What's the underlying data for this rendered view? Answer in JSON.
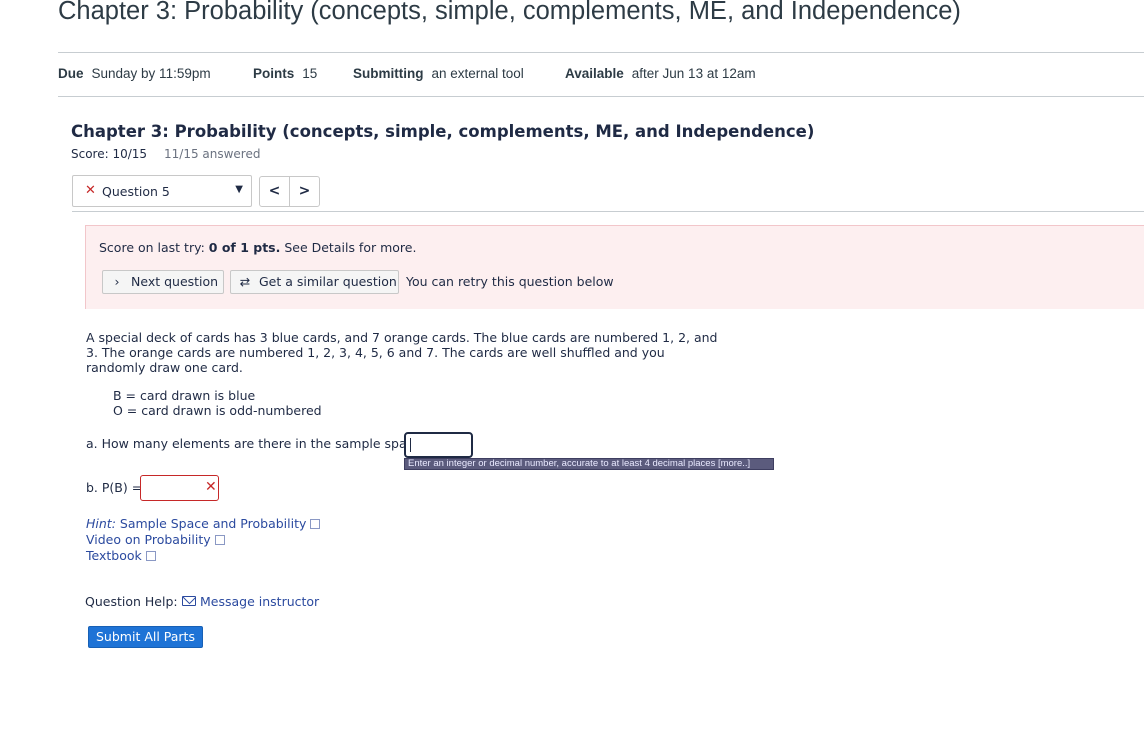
{
  "header": {
    "title": "Chapter 3: Probability (concepts, simple, complements, ME, and Independence)",
    "due_label": "Due",
    "due_value": "Sunday by 11:59pm",
    "points_label": "Points",
    "points_value": "15",
    "submitting_label": "Submitting",
    "submitting_value": "an external tool",
    "available_label": "Available",
    "available_value": "after Jun 13 at 12am"
  },
  "quiz": {
    "title": "Chapter 3: Probability (concepts, simple, complements, ME, and Independence)",
    "score_label": "Score:",
    "score_value": "10/15",
    "answered": "11/15 answered",
    "question_select": "Question 5",
    "prev_label": "<",
    "next_label": ">"
  },
  "score_panel": {
    "prefix": "Score on last try: ",
    "score": "0 of 1 pts.",
    "suffix": " See Details for more.",
    "next_question_label": "Next question",
    "similar_question_label": "Get a similar question",
    "retry_note": "You can retry this question below"
  },
  "question": {
    "text": "A special deck of cards has 3 blue cards, and 7 orange cards. The blue cards are numbered 1, 2, and 3. The orange cards are numbered 1, 2, 3, 4, 5, 6 and 7. The cards are well shuffled and you randomly draw one card.",
    "def_b": "B = card drawn is blue",
    "def_o": "O = card drawn is odd-numbered",
    "part_a_label": "a. How many elements are there in the sample space?",
    "part_a_value": "",
    "tooltip": "Enter an integer or decimal number, accurate to at least 4 decimal places [more..]",
    "part_b_label": "b. P(B) =",
    "part_b_value": ""
  },
  "links": {
    "hint_prefix": "Hint:",
    "hint_link": "Sample Space and Probability",
    "video_link": "Video on Probability",
    "textbook_link": "Textbook"
  },
  "help": {
    "label": "Question Help:",
    "message_link": "Message instructor"
  },
  "submit_label": "Submit All Parts",
  "colors": {
    "accent": "#1e73d6",
    "error": "#c62828",
    "panel_bg": "#fdeff0",
    "link": "#2b4a9f"
  }
}
